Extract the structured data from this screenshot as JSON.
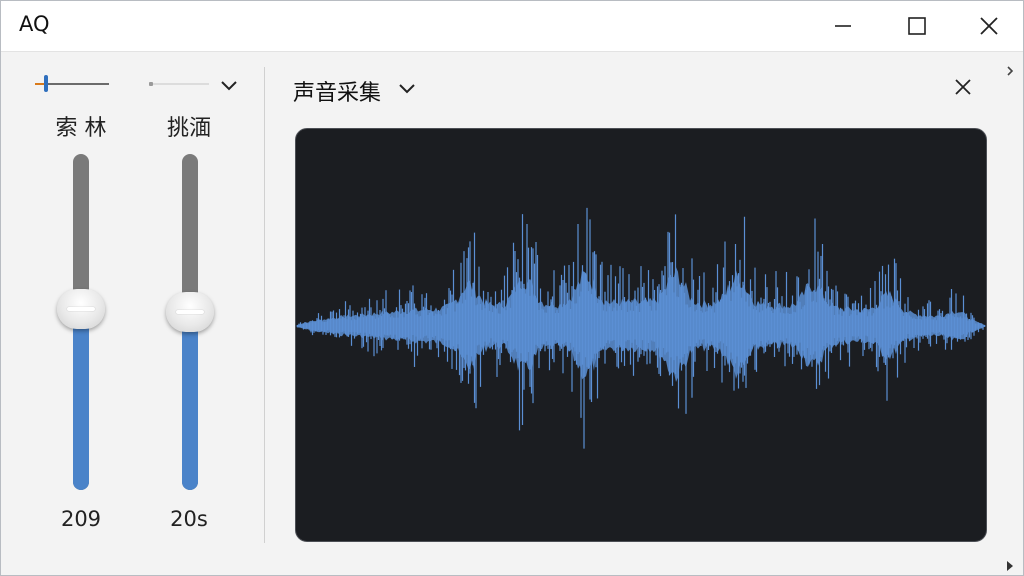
{
  "window": {
    "title": "AQ",
    "controls": [
      "minimize-icon",
      "maximize-icon",
      "close-icon"
    ]
  },
  "mixer": {
    "channels": [
      {
        "label": "索 林",
        "value": "209",
        "level": 0.54,
        "mini_level": 0.15,
        "color": "#4a83c9"
      },
      {
        "label": "挑湎",
        "value": "20s",
        "level": 0.53,
        "mini_level": 0.0,
        "color": "#4a83c9"
      }
    ],
    "dropdown_icon": "chevron-down-icon"
  },
  "capture": {
    "title": "声音采集",
    "dropdown_icon": "chevron-down-icon",
    "close_icon": "close-icon",
    "waveform_color": "#5b8fd4",
    "background_color": "#1b1d21"
  }
}
